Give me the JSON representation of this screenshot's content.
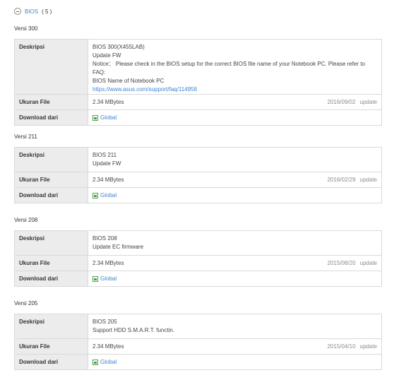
{
  "header": {
    "title": "BIOS",
    "count": "( 5 )"
  },
  "labels": {
    "description": "Deskripsi",
    "file_size": "Ukuran File",
    "download_from": "Download dari"
  },
  "versions": [
    {
      "title": "Versi 300",
      "description_lines": [
        "BIOS 300(X455LAB)",
        "Update FW",
        "Notice： Please check in the BIOS setup for the correct BIOS file name of your Notebook PC. Please refer to FAQ:",
        "BIOS Name of Notebook PC"
      ],
      "description_link": "https://www.asus.com/support/faq/114958",
      "size": "2.34 MBytes",
      "date": "2016/09/02",
      "update": "update",
      "download": "Global"
    },
    {
      "title": "Versi 211",
      "description_lines": [
        "BIOS 211",
        "Update FW"
      ],
      "size": "2.34 MBytes",
      "date": "2016/02/29",
      "update": "update",
      "download": "Global"
    },
    {
      "title": "Versi 208",
      "description_lines": [
        "BIOS 208",
        "Update EC firmware"
      ],
      "size": "2.34 MBytes",
      "date": "2015/08/20",
      "update": "update",
      "download": "Global"
    },
    {
      "title": "Versi 205",
      "description_lines": [
        "BIOS 205",
        "Support HDD S.M.A.R.T. functin."
      ],
      "size": "2.34 MBytes",
      "date": "2015/04/10",
      "update": "update",
      "download": "Global"
    }
  ],
  "colors": {
    "link": "#3a86d4",
    "label_bg": "#ececec",
    "border": "#d9d9d9",
    "download_icon": "#4aa04a"
  },
  "icons": {
    "collapse": "minus-circle-icon",
    "download": "save-icon"
  }
}
